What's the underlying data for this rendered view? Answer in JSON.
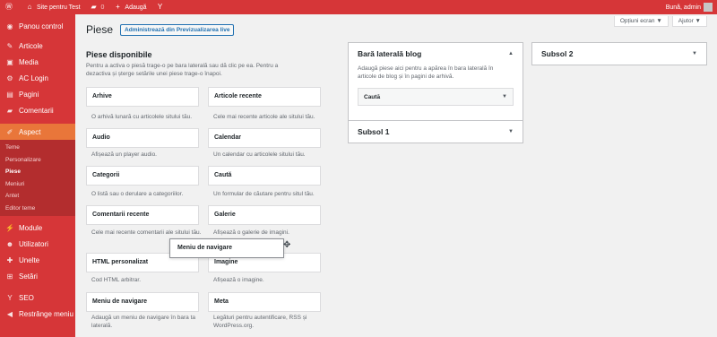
{
  "adminbar": {
    "site_name": "Site pentru Test",
    "comments_count": "0",
    "new_label": "Adaugă",
    "greeting": "Bună, admin"
  },
  "sidebar": {
    "items": [
      {
        "label": "Panou control",
        "icon": "dashboard-icon"
      },
      {
        "label": "Articole",
        "icon": "pin-icon"
      },
      {
        "label": "Media",
        "icon": "media-icon"
      },
      {
        "label": "AC Login",
        "icon": "lock-icon"
      },
      {
        "label": "Pagini",
        "icon": "page-icon"
      },
      {
        "label": "Comentarii",
        "icon": "comment-icon"
      },
      {
        "label": "Aspect",
        "icon": "brush-icon"
      }
    ],
    "submenu": [
      "Teme",
      "Personalizare",
      "Piese",
      "Meniuri",
      "Antet",
      "Editor teme"
    ],
    "items_after": [
      {
        "label": "Module",
        "icon": "plugin-icon"
      },
      {
        "label": "Utilizatori",
        "icon": "user-icon"
      },
      {
        "label": "Unelte",
        "icon": "wrench-icon"
      },
      {
        "label": "Setări",
        "icon": "settings-icon"
      },
      {
        "label": "SEO",
        "icon": "seo-icon"
      },
      {
        "label": "Restrânge meniu",
        "icon": "collapse-icon"
      }
    ]
  },
  "screen": {
    "options_label": "Opțiuni ecran ▼",
    "help_label": "Ajutor ▼"
  },
  "page": {
    "title": "Piese",
    "live_button": "Administrează din Previzualizarea live"
  },
  "available": {
    "title": "Piese disponibile",
    "description": "Pentru a activa o piesă trage-o pe bara laterală sau dă clic pe ea. Pentru a dezactiva și șterge setările unei piese trage-o înapoi.",
    "widgets": [
      {
        "name": "Arhive",
        "desc": "O arhivă lunară cu articolele sitului tău."
      },
      {
        "name": "Articole recente",
        "desc": "Cele mai recente articole ale sitului tău."
      },
      {
        "name": "Audio",
        "desc": "Afișează un player audio."
      },
      {
        "name": "Calendar",
        "desc": "Un calendar cu articolele sitului tău."
      },
      {
        "name": "Categorii",
        "desc": "O listă sau o derulare a categoriilor."
      },
      {
        "name": "Caută",
        "desc": "Un formular de căutare pentru situl tău."
      },
      {
        "name": "Comentarii recente",
        "desc": "Cele mai recente comentarii ale sitului tău."
      },
      {
        "name": "Galerie",
        "desc": "Afișează o galerie de imagini."
      },
      {
        "name": "HTML personalizat",
        "desc": "Cod HTML arbitrar."
      },
      {
        "name": "Imagine",
        "desc": "Afișează o imagine."
      },
      {
        "name": "Meniu de navigare",
        "desc": "Adaugă un meniu de navigare în bara ta laterală."
      },
      {
        "name": "Meta",
        "desc": "Legături pentru autentificare, RSS și WordPress.org."
      }
    ],
    "dragging": "Meniu de navigare"
  },
  "areas": {
    "blog_sidebar": {
      "title": "Bară laterală blog",
      "description": "Adaugă piese aici pentru a apărea în bara laterală în articole de blog și în pagini de arhivă.",
      "widget": "Caută"
    },
    "footer1": {
      "title": "Subsol 1"
    },
    "footer2": {
      "title": "Subsol 2"
    }
  }
}
